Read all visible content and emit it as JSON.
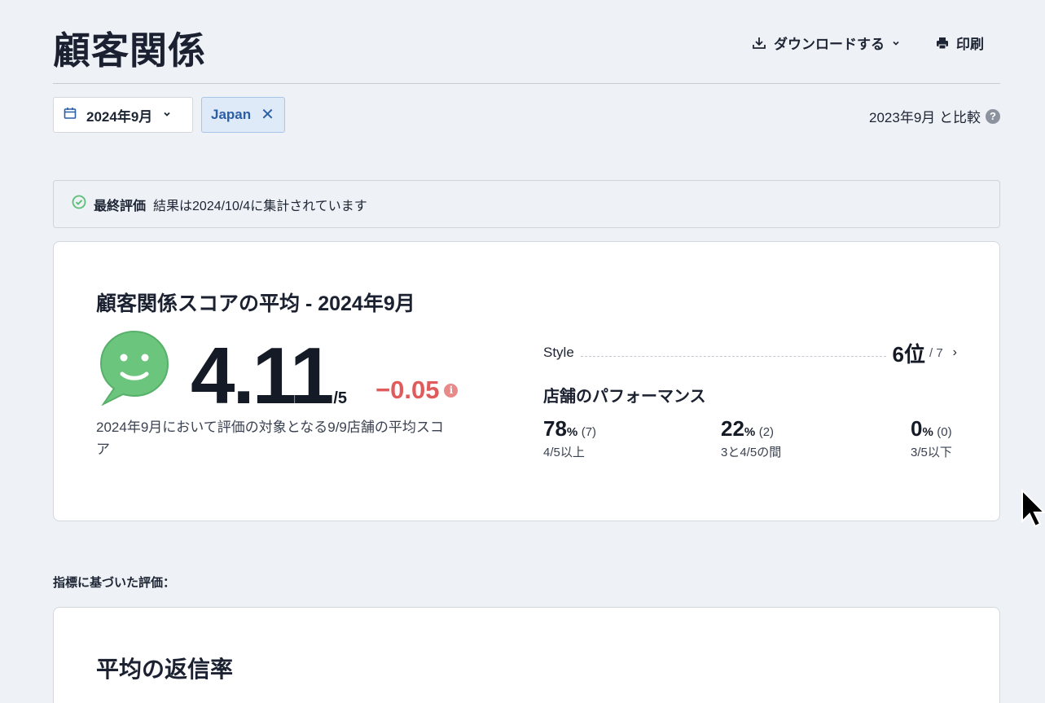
{
  "header": {
    "title": "顧客関係",
    "download_label": "ダウンロードする",
    "print_label": "印刷"
  },
  "filters": {
    "date": "2024年9月",
    "location_chip": "Japan",
    "chip_close": "✕",
    "compare_text": "2023年9月 と比較",
    "help_glyph": "?"
  },
  "notice": {
    "strong": "最終評価",
    "text": "結果は2024/10/4に集計されています"
  },
  "summary": {
    "title": "顧客関係スコアの平均 - 2024年9月",
    "score": "4.11",
    "score_max": "/5",
    "delta": "−0.05",
    "info_glyph": "i",
    "description": "2024年9月において評価の対象となる9/9店舗の平均スコア",
    "ranking": {
      "label": "Style",
      "value": "6位",
      "total": "/ 7",
      "chevron": "›"
    },
    "performance": {
      "title": "店舗のパフォーマンス",
      "stats": [
        {
          "value": "78",
          "pct": "%",
          "count": "(7)",
          "label": "4/5以上"
        },
        {
          "value": "22",
          "pct": "%",
          "count": "(2)",
          "label": "3と4/5の間"
        },
        {
          "value": "0",
          "pct": "%",
          "count": "(0)",
          "label": "3/5以下"
        }
      ]
    }
  },
  "metrics": {
    "section_label": "指標に基づいた評価：",
    "card_title": "平均の返信率"
  },
  "icons": {
    "download": "download-icon",
    "print": "printer-icon",
    "calendar": "calendar-icon",
    "check": "check-circle-icon",
    "smiley": "smiley-speech-bubble-icon"
  },
  "colors": {
    "background": "#eef1f5",
    "chip_bg": "#dfeaf8",
    "chip_text": "#2a5fa8",
    "negative": "#e05b5b",
    "smiley_green": "#6cc57d",
    "check_green": "#5cbf76"
  }
}
